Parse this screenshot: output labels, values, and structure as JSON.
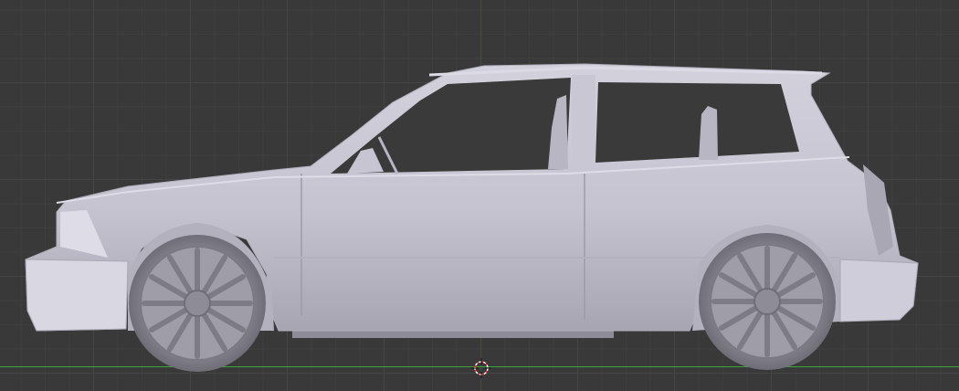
{
  "colors": {
    "background": "#393939",
    "grid": "#454545",
    "axis_vertical": "#2b2bc6",
    "axis_horizontal": "#3aa63a",
    "car_body": "#c7c5d2",
    "car_shadow": "#9f9dab",
    "glass": "#3a3a3a",
    "wheel": "#8d8c96"
  },
  "icons": {
    "cursor": "3d-cursor-icon"
  }
}
